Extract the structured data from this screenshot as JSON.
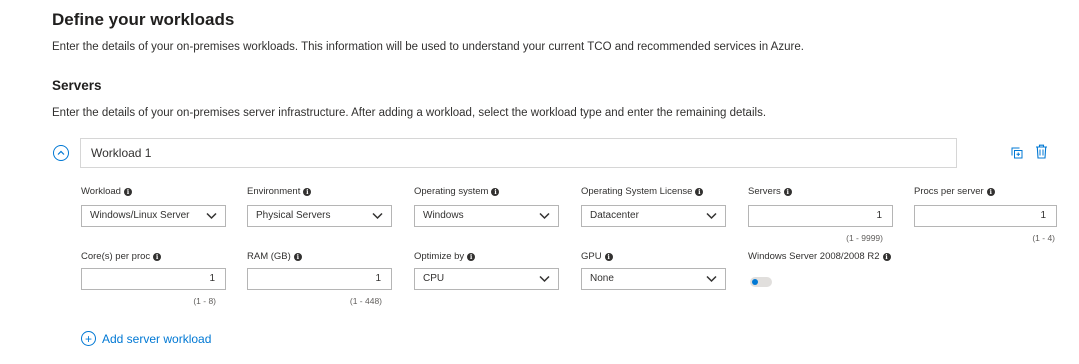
{
  "header": {
    "title": "Define your workloads",
    "description": "Enter the details of your on-premises workloads. This information will be used to understand your current TCO and recommended services in Azure."
  },
  "servers": {
    "title": "Servers",
    "description": "Enter the details of your on-premises server infrastructure. After adding a workload, select the workload type and enter the remaining details."
  },
  "workload": {
    "name": "Workload 1",
    "info_icon_glyph": "i",
    "fields": {
      "workload": {
        "label": "Workload",
        "value": "Windows/Linux Server"
      },
      "environment": {
        "label": "Environment",
        "value": "Physical Servers"
      },
      "operating_system": {
        "label": "Operating system",
        "value": "Windows"
      },
      "os_license": {
        "label": "Operating System License",
        "value": "Datacenter"
      },
      "servers": {
        "label": "Servers",
        "value": "1",
        "range": "(1 - 9999)"
      },
      "procs_per_server": {
        "label": "Procs per server",
        "value": "1",
        "range": "(1 - 4)"
      },
      "cores_per_proc": {
        "label": "Core(s) per proc",
        "value": "1",
        "range": "(1 - 8)"
      },
      "ram": {
        "label": "RAM (GB)",
        "value": "1",
        "range": "(1 - 448)"
      },
      "optimize_by": {
        "label": "Optimize by",
        "value": "CPU"
      },
      "gpu": {
        "label": "GPU",
        "value": "None"
      },
      "windows_server_2008": {
        "label": "Windows Server 2008/2008 R2",
        "on": false
      }
    }
  },
  "actions": {
    "add_server_workload": "Add server workload",
    "plus_glyph": "+"
  },
  "colors": {
    "accent": "#0078d4",
    "text": "#323130",
    "border": "#b5b5b5"
  },
  "icons": [
    "chevron-up-icon",
    "copy-icon",
    "delete-icon",
    "info-icon",
    "chevron-down-icon",
    "plus-circle-icon"
  ]
}
